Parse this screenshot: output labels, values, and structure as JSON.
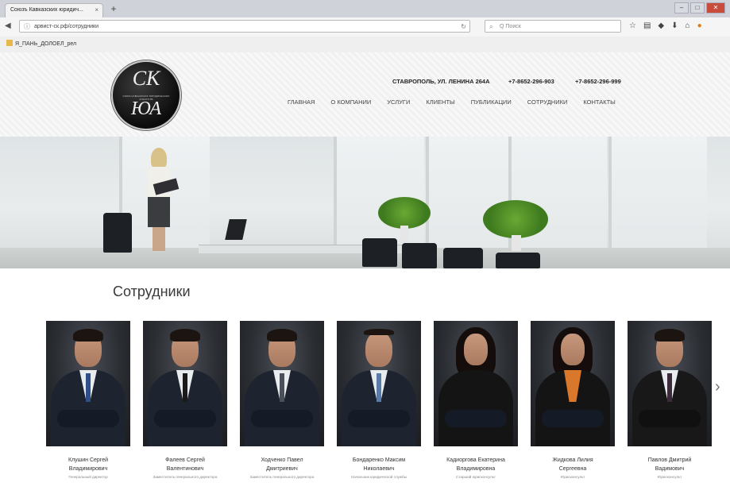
{
  "browser": {
    "tab_title": "Союзъ Кавказских юридич...",
    "tab_close": "×",
    "new_tab": "+",
    "url": "арвист-ск.рф/сотрудники",
    "search_placeholder": "Q Поиск",
    "bookmark": "Я_ПАНЬ_ДОЛОЕЛ_рел"
  },
  "site": {
    "logo_top": "СК",
    "logo_small": "СОЮЗ КАВКАЗСКИХ ЮРИДИЧЕСКИХ АГЕНТСТВ",
    "logo_bottom": "ЮА",
    "address": "СТАВРОПОЛЬ, УЛ. ЛЕНИНА 264А",
    "phone1": "+7-8652-296-903",
    "phone2": "+7-8652-296-999",
    "menu": [
      "ГЛАВНАЯ",
      "О КОМПАНИИ",
      "УСЛУГИ",
      "КЛИЕНТЫ",
      "ПУБЛИКАЦИИ",
      "СОТРУДНИКИ",
      "КОНТАКТЫ"
    ]
  },
  "staff": {
    "title": "Сотрудники",
    "next_arrow": "›",
    "people": [
      {
        "name": "Клушин Сергей",
        "name2": "Владимирович",
        "role": "Генеральный директор"
      },
      {
        "name": "Фалеев Сергей",
        "name2": "Валентинович",
        "role": "Заместитель генерального директора"
      },
      {
        "name": "Ходченко Павел",
        "name2": "Дмитриевич",
        "role": "Заместитель генерального директора"
      },
      {
        "name": "Бондаренко Максим",
        "name2": "Николаевич",
        "role": "Начальник юридической службы"
      },
      {
        "name": "Кадиоргова Екатерина",
        "name2": "Владимировна",
        "role": "Старший юрисконсульт"
      },
      {
        "name": "Жидкова Лилия",
        "name2": "Сергеевна",
        "role": "Юрисконсульт"
      },
      {
        "name": "Павлов Дмитрий",
        "name2": "Вадимович",
        "role": "Юрисконсульт"
      }
    ]
  }
}
